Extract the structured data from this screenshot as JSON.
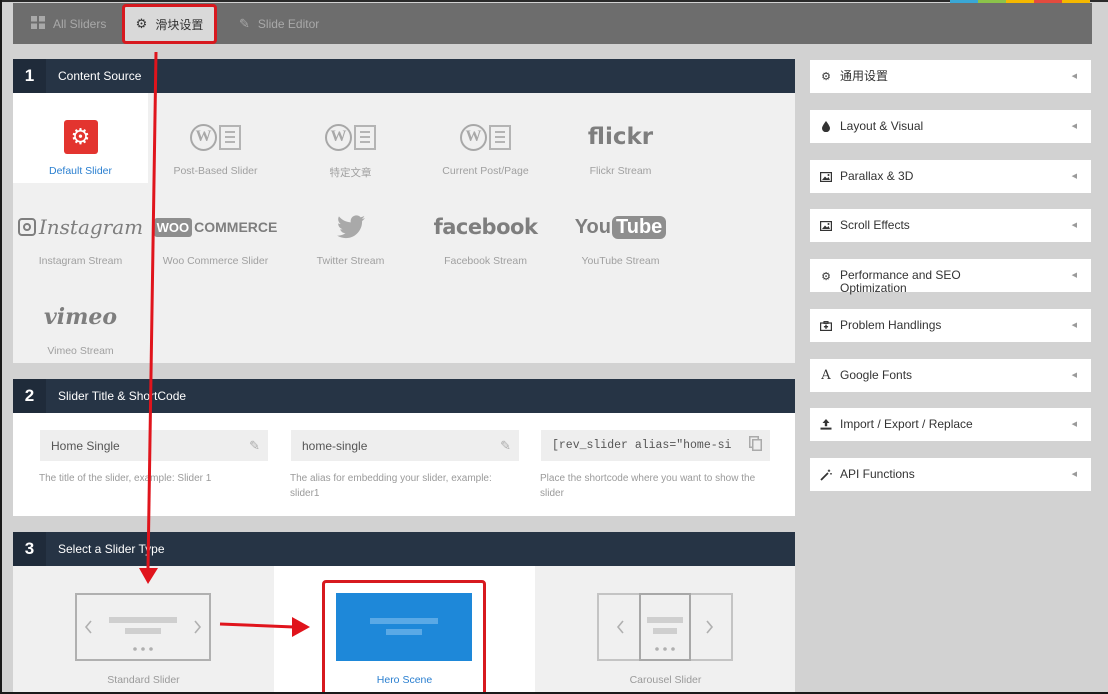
{
  "topbar": {
    "tabs": [
      {
        "label": "All Sliders",
        "icon": "grid-icon"
      },
      {
        "label": "滑块设置",
        "icon": "gear-icon"
      },
      {
        "label": "Slide Editor",
        "icon": "pencil-icon"
      }
    ]
  },
  "content_source": {
    "number": "1",
    "title": "Content Source",
    "sources": [
      {
        "label": "Default Slider",
        "icon": "gear-icon",
        "active": true
      },
      {
        "label": "Post-Based Slider",
        "icon": "wordpress-icon"
      },
      {
        "label": "特定文章",
        "icon": "wordpress-icon"
      },
      {
        "label": "Current Post/Page",
        "icon": "wordpress-icon"
      },
      {
        "label": "Flickr Stream",
        "brand": "flickr"
      },
      {
        "label": "Instagram Stream",
        "brand": "Instagram"
      },
      {
        "label": "Woo Commerce Slider",
        "brand_a": "WOO",
        "brand_b": "COMMERCE"
      },
      {
        "label": "Twitter Stream",
        "icon": "twitter-bird-icon"
      },
      {
        "label": "Facebook Stream",
        "brand": "facebook"
      },
      {
        "label": "YouTube Stream",
        "brand_a": "You",
        "brand_b": "Tube"
      },
      {
        "label": "Vimeo Stream",
        "brand": "vimeo"
      }
    ]
  },
  "title_shortcode": {
    "number": "2",
    "title": "Slider Title & ShortCode",
    "title_field": {
      "value": "Home Single",
      "hint": "The title of the slider, example: Slider 1"
    },
    "alias_field": {
      "value": "home-single",
      "hint": "The alias for embedding your slider, example: slider1"
    },
    "shortcode_field": {
      "value": "[rev_slider alias=\"home-si",
      "hint": "Place the shortcode where you want to show the slider"
    }
  },
  "slider_type": {
    "number": "3",
    "title": "Select a Slider Type",
    "types": [
      {
        "label": "Standard Slider"
      },
      {
        "label": "Hero Scene",
        "active": true
      },
      {
        "label": "Carousel Slider"
      }
    ]
  },
  "settings_accordion": [
    {
      "label": "通用设置",
      "icon": "gears-icon"
    },
    {
      "label": "Layout & Visual",
      "icon": "drop-icon"
    },
    {
      "label": "Parallax & 3D",
      "icon": "image-icon"
    },
    {
      "label": "Scroll Effects",
      "icon": "image-icon"
    },
    {
      "label": "Performance and SEO Optimization",
      "icon": "gears-icon"
    },
    {
      "label": "Problem Handlings",
      "icon": "medkit-icon"
    },
    {
      "label": "Google Fonts",
      "icon": "font-icon"
    },
    {
      "label": "Import / Export / Replace",
      "icon": "upload-icon"
    },
    {
      "label": "API Functions",
      "icon": "magic-wand-icon"
    }
  ],
  "colors": {
    "panel_header": "#263445",
    "highlight_red": "#d7191f",
    "hero_blue": "#1e88d9",
    "active_label": "#2a7fd0"
  }
}
